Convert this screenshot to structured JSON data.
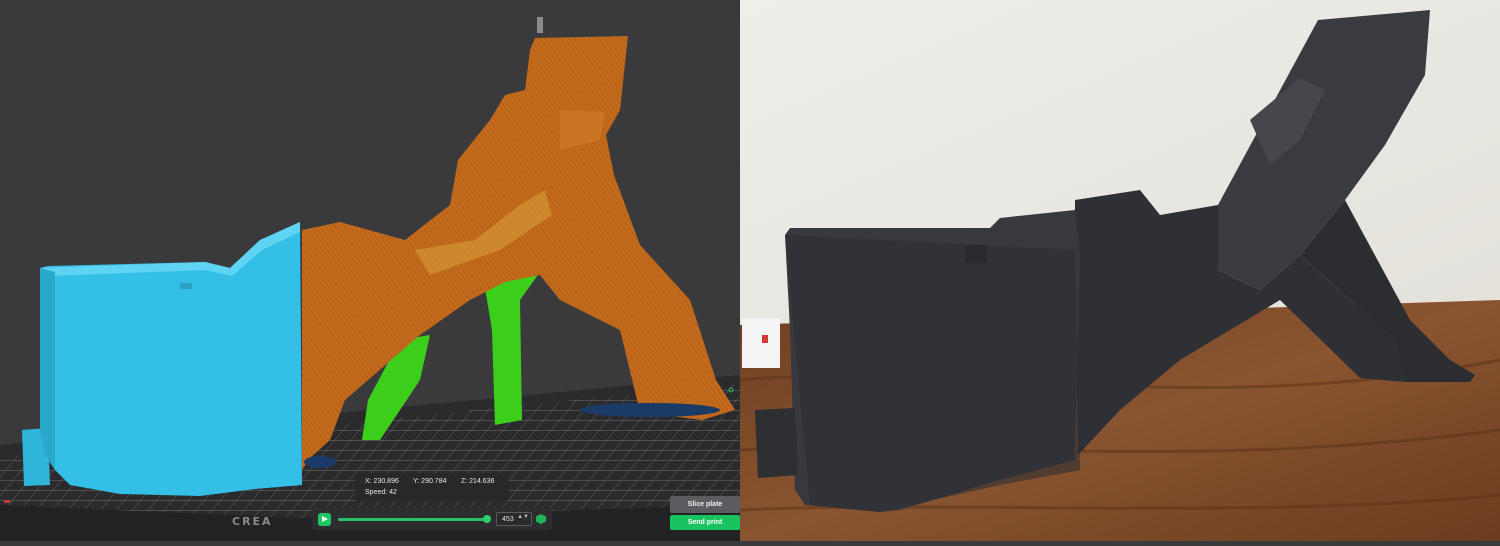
{
  "viewer": {
    "bed_logo": "CREA",
    "coords": {
      "x": "X: 230.896",
      "y": "Y: 290.784",
      "z": "Z: 214.636",
      "speed": "Speed: 42"
    },
    "layer": {
      "value": "453",
      "stepper": "▲▼"
    },
    "buttons": {
      "slice": "Slice plate",
      "send": "Send print"
    }
  },
  "colors": {
    "viewport_bg": "#3a3a3c",
    "model_blue": "#34c0e6",
    "model_orange": "#c26b1d",
    "support_green": "#3bcf1c",
    "accent_green": "#1ec65f",
    "photo_part": "#2f2f33",
    "wall": "#ecebe6",
    "table": "#7a4a27"
  }
}
